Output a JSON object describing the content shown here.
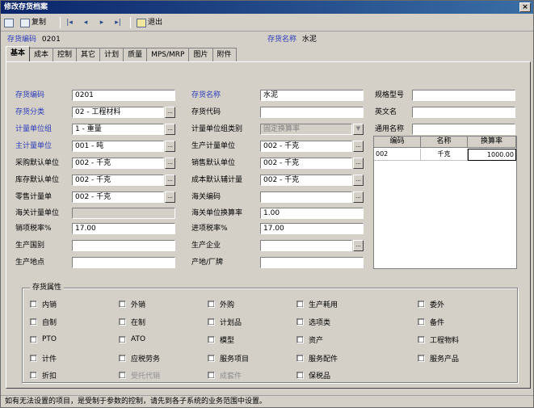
{
  "window": {
    "title": "修改存货档案",
    "close": "×"
  },
  "toolbar": {
    "save": "",
    "copy_label": "复制",
    "exit_label": "退出"
  },
  "header": {
    "code_label": "存货编码",
    "code_value": "0201",
    "name_label": "存货名称",
    "name_value": "水泥"
  },
  "tabs": [
    "基本",
    "成本",
    "控制",
    "其它",
    "计划",
    "质量",
    "MPS/MRP",
    "图片",
    "附件"
  ],
  "active_tab": 0,
  "form": {
    "inv_code": {
      "label": "存货编码",
      "value": "0201"
    },
    "inv_class": {
      "label": "存货分类",
      "value": "02 - 工程材料"
    },
    "unit_group": {
      "label": "计量单位组",
      "value": "1 - 重量"
    },
    "main_unit": {
      "label": "主计量单位",
      "value": "001 - 吨"
    },
    "purchase_unit": {
      "label": "采购默认单位",
      "value": "002 - 千克"
    },
    "stock_unit": {
      "label": "库存默认单位",
      "value": "002 - 千克"
    },
    "retail_unit": {
      "label": "零售计量单",
      "value": "002 - 千克"
    },
    "customs_unit": {
      "label": "海关计量单位",
      "value": ""
    },
    "sales_tax": {
      "label": "销项税率%",
      "value": "17.00"
    },
    "origin": {
      "label": "生产国别",
      "value": ""
    },
    "place": {
      "label": "生产地点",
      "value": ""
    },
    "inv_name": {
      "label": "存货名称",
      "value": "水泥"
    },
    "inv_code2": {
      "label": "存货代码",
      "value": ""
    },
    "unit_group_type": {
      "label": "计量单位组类别",
      "value": "固定换算率"
    },
    "prod_unit": {
      "label": "生产计量单位",
      "value": "002 - 千克"
    },
    "sales_unit": {
      "label": "销售默认单位",
      "value": "002 - 千克"
    },
    "cost_unit": {
      "label": "成本默认辅计量",
      "value": "002 - 千克"
    },
    "customs_code": {
      "label": "海关编码",
      "value": ""
    },
    "customs_rate": {
      "label": "海关单位换算率",
      "value": "1.00"
    },
    "purchase_tax": {
      "label": "进项税率%",
      "value": "17.00"
    },
    "manufacturer": {
      "label": "生产企业",
      "value": ""
    },
    "producer": {
      "label": "产地/厂牌",
      "value": ""
    },
    "spec": {
      "label": "规格型号",
      "value": ""
    },
    "eng_name": {
      "label": "英文名",
      "value": ""
    },
    "common_name": {
      "label": "通用名称",
      "value": ""
    }
  },
  "unit_grid": {
    "headers": [
      "编码",
      "名称",
      "换算率"
    ],
    "rows": [
      [
        "002",
        "千克",
        "1000.00"
      ]
    ]
  },
  "attributes": {
    "title": "存货属性",
    "items": [
      {
        "label": "内销",
        "disabled": false
      },
      {
        "label": "外销",
        "disabled": false
      },
      {
        "label": "外购",
        "disabled": false
      },
      {
        "label": "生产耗用",
        "disabled": false
      },
      {
        "label": "委外",
        "disabled": false
      },
      {
        "label": "自制",
        "disabled": false
      },
      {
        "label": "在制",
        "disabled": false
      },
      {
        "label": "计划品",
        "disabled": false
      },
      {
        "label": "选项类",
        "disabled": false
      },
      {
        "label": "备件",
        "disabled": false
      },
      {
        "label": "PTO",
        "disabled": false
      },
      {
        "label": "ATO",
        "disabled": false
      },
      {
        "label": "模型",
        "disabled": false
      },
      {
        "label": "资产",
        "disabled": false
      },
      {
        "label": "工程物料",
        "disabled": false
      },
      {
        "label": "计件",
        "disabled": false
      },
      {
        "label": "应税劳务",
        "disabled": false
      },
      {
        "label": "服务项目",
        "disabled": false
      },
      {
        "label": "服务配件",
        "disabled": false
      },
      {
        "label": "服务产品",
        "disabled": false
      },
      {
        "label": "折扣",
        "disabled": false
      },
      {
        "label": "受托代销",
        "disabled": true
      },
      {
        "label": "成套件",
        "disabled": true
      },
      {
        "label": "保税品",
        "disabled": false
      }
    ]
  },
  "status": "如有无法设置的项目，是受制于参数的控制，请先到各子系统的业务范围中设置。"
}
